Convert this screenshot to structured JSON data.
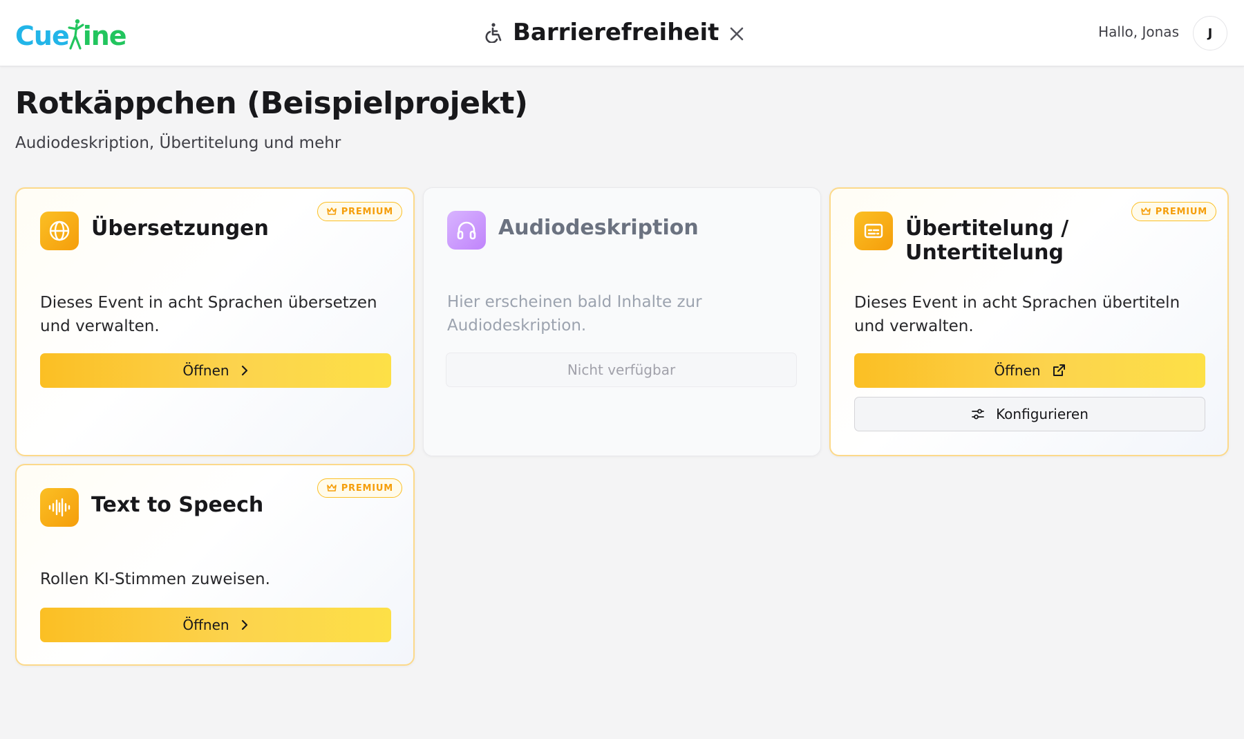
{
  "header": {
    "logo_part1": "Cue",
    "logo_part2": "ine",
    "title": "Barrierefreiheit",
    "greeting": "Hallo, Jonas",
    "avatar_initial": "J"
  },
  "project": {
    "title": "Rotkäppchen (Beispielprojekt)",
    "subtitle": "Audiodeskription, Übertitelung und mehr"
  },
  "premium_label": "PREMIUM",
  "cards": [
    {
      "title": "Übersetzungen",
      "description": "Dieses Event in acht Sprachen übersetzen und verwalten.",
      "button": "Öffnen",
      "icon": "globe-icon",
      "premium": true
    },
    {
      "title": "Audiodeskription",
      "description": "Hier erscheinen bald Inhalte zur Audiodeskription.",
      "button": "Nicht verfügbar",
      "icon": "headphones-icon",
      "premium": false,
      "disabled": true
    },
    {
      "title": "Übertitelung / Untertitelung",
      "description": "Dieses Event in acht Sprachen übertiteln und verwalten.",
      "button": "Öffnen",
      "secondary_button": "Konfigurieren",
      "icon": "subtitles-icon",
      "premium": true
    },
    {
      "title": "Text to Speech",
      "description": "Rollen KI-Stimmen zuweisen.",
      "button": "Öffnen",
      "icon": "audio-wave-icon",
      "premium": true
    }
  ],
  "colors": {
    "accent_yellow": "#fbbf24",
    "logo_blue": "#22b5e8",
    "logo_green": "#22c55e",
    "premium_text": "#f59e0b",
    "disabled_icon": "#c084fc"
  }
}
